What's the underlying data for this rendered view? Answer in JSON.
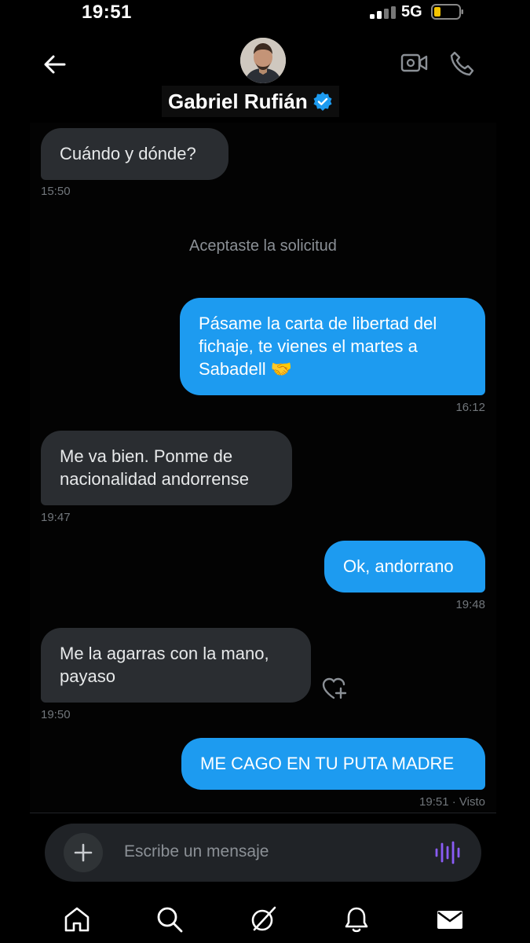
{
  "status": {
    "time": "19:51",
    "network": "5G"
  },
  "header": {
    "title": "Gabriel Rufián"
  },
  "messages": [
    {
      "dir": "in",
      "text": "Cuándo y dónde?",
      "time": "15:50"
    },
    {
      "dir": "system",
      "text": "Aceptaste la solicitud"
    },
    {
      "dir": "out",
      "text": "Pásame la carta de libertad del\nfichaje, te vienes el martes a\nSabadell 🤝",
      "time": "16:12"
    },
    {
      "dir": "in",
      "text": "Me va bien. Ponme de\nnacionalidad andorrense",
      "time": "19:47"
    },
    {
      "dir": "out",
      "text": "Ok, andorrano",
      "time": "19:48"
    },
    {
      "dir": "in",
      "text": "Me la agarras con la mano,\npayaso",
      "time": "19:50"
    },
    {
      "dir": "out",
      "text": "ME CAGO EN TU PUTA MADRE",
      "time": "19:51 · Visto"
    }
  ],
  "composer": {
    "placeholder": "Escribe un mensaje"
  },
  "tabs": [
    "home",
    "search",
    "grok",
    "notifications",
    "messages"
  ],
  "icons": {
    "back": "back-arrow-icon",
    "video": "video-icon",
    "phone": "phone-icon",
    "verified": "verified-badge-icon",
    "plus": "plus-icon",
    "voice": "voice-icon",
    "react": "heart-plus-icon"
  },
  "colors": {
    "accent": "#1d9bf0",
    "incoming": "#2a2d31",
    "background": "#000000",
    "voice": "#8a5cf6"
  }
}
